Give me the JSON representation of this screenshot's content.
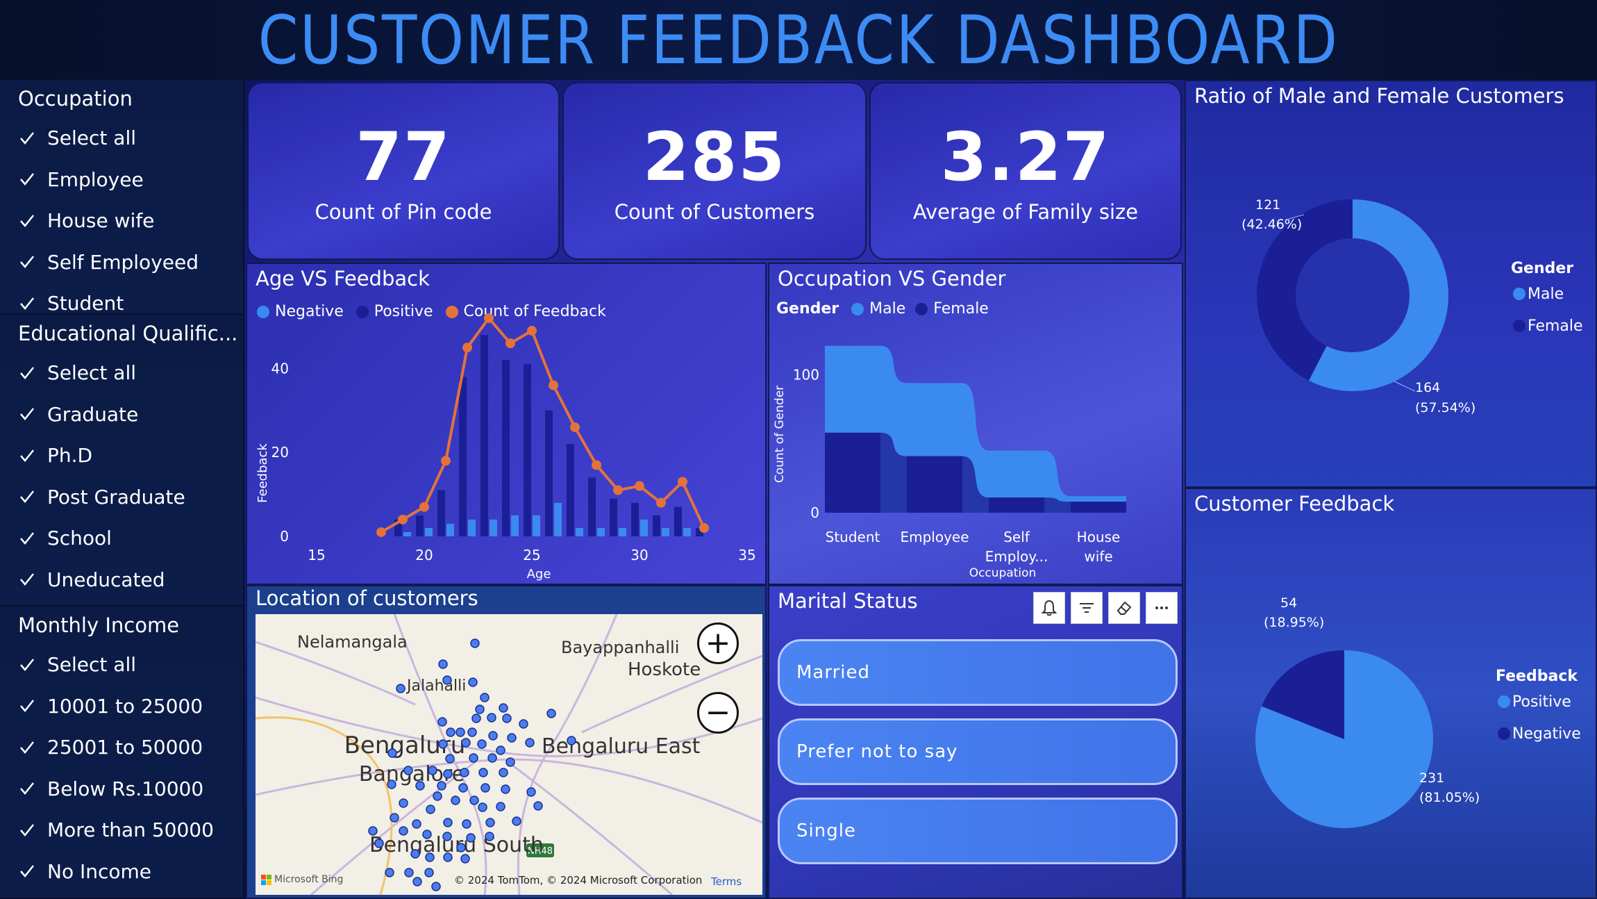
{
  "header": {
    "title": "CUSTOMER FEEDBACK DASHBOARD"
  },
  "slicers": {
    "occupation": {
      "title": "Occupation",
      "items": [
        "Select all",
        "Employee",
        "House wife",
        "Self Employeed",
        "Student"
      ]
    },
    "education": {
      "title": "Educational Qualific...",
      "items": [
        "Select all",
        "Graduate",
        "Ph.D",
        "Post Graduate",
        "School",
        "Uneducated"
      ]
    },
    "income": {
      "title": "Monthly Income",
      "items": [
        "Select all",
        "10001 to 25000",
        "25001 to 50000",
        "Below Rs.10000",
        "More than 50000",
        "No Income"
      ]
    }
  },
  "kpis": [
    {
      "value": "77",
      "label": "Count of Pin code"
    },
    {
      "value": "285",
      "label": "Count of Customers"
    },
    {
      "value": "3.27",
      "label": "Average of Family size"
    }
  ],
  "colors": {
    "light_blue": "#3b8af0",
    "dark_blue": "#1a1f96",
    "orange": "#e3733a",
    "title_blue": "#3d8cf5"
  },
  "age_chart": {
    "title": "Age VS Feedback",
    "legend": [
      "Negative",
      "Positive",
      "Count of Feedback"
    ]
  },
  "occupation_chart": {
    "title": "Occupation VS Gender",
    "legend_title": "Gender",
    "legend": [
      "Male",
      "Female"
    ],
    "ylabel": "Count of Gender",
    "xlabel": "Occupation",
    "categories": [
      "Student",
      "Employee",
      "Self Employ...",
      "House wife"
    ],
    "yticks": [
      "100",
      "0"
    ]
  },
  "gender_chart": {
    "title": "Ratio of Male and Female Customers",
    "legend_title": "Gender",
    "legend": [
      "Male",
      "Female"
    ],
    "male_label": "164",
    "male_pct": "(57.54%)",
    "female_label": "121",
    "female_pct": "(42.46%)"
  },
  "feedback_chart": {
    "title": "Customer Feedback",
    "legend_title": "Feedback",
    "legend": [
      "Positive",
      "Negative"
    ],
    "positive_label": "231",
    "positive_pct": "(81.05%)",
    "negative_label": "54",
    "negative_pct": "(18.95%)"
  },
  "map": {
    "title": "Location of customers",
    "places": [
      "Nelamangala",
      "Bayappanhalli",
      "Hoskote",
      "Jalahalli",
      "Bengaluru",
      "Bengaluru East",
      "Bangalore",
      "Bengaluru South"
    ],
    "road_label": "NH48",
    "provider": "Microsoft Bing",
    "copyright": "© 2024 TomTom, © 2024 Microsoft Corporation",
    "terms": "Terms",
    "zoom_in": "+",
    "zoom_out": "−"
  },
  "marital": {
    "title": "Marital Status",
    "items": [
      "Married",
      "Prefer not to say",
      "Single"
    ]
  },
  "chart_data": [
    {
      "type": "bar",
      "title": "Age VS Feedback",
      "xlabel": "Age",
      "ylabel": "Feedback",
      "xlim": [
        15,
        35
      ],
      "ylim": [
        0,
        50
      ],
      "xticks": [
        15,
        20,
        25,
        30,
        35
      ],
      "yticks": [
        0,
        20,
        40
      ],
      "x": [
        18,
        19,
        20,
        21,
        22,
        23,
        24,
        25,
        26,
        27,
        28,
        29,
        30,
        31,
        32,
        33
      ],
      "series": [
        {
          "name": "Negative",
          "values": [
            0,
            1,
            2,
            3,
            4,
            4,
            5,
            5,
            8,
            2,
            2,
            2,
            4,
            2,
            2,
            0
          ]
        },
        {
          "name": "Positive",
          "values": [
            0,
            4,
            5,
            11,
            38,
            48,
            42,
            41,
            30,
            22,
            14,
            9,
            8,
            5,
            7,
            2
          ]
        },
        {
          "name": "Count of Feedback",
          "values": [
            1,
            4,
            7,
            18,
            45,
            52,
            46,
            49,
            36,
            26,
            17,
            11,
            12,
            8,
            13,
            2
          ]
        }
      ]
    },
    {
      "type": "area",
      "title": "Occupation VS Gender",
      "categories": [
        "Student",
        "Employee",
        "Self Employ...",
        "House wife"
      ],
      "series": [
        {
          "name": "Male",
          "values": [
            63,
            53,
            34,
            4
          ]
        },
        {
          "name": "Female",
          "values": [
            58,
            41,
            11,
            8
          ]
        }
      ]
    },
    {
      "type": "pie",
      "title": "Ratio of Male and Female Customers",
      "categories": [
        "Male",
        "Female"
      ],
      "values": [
        164,
        121
      ]
    },
    {
      "type": "pie",
      "title": "Customer Feedback",
      "categories": [
        "Positive",
        "Negative"
      ],
      "values": [
        231,
        54
      ]
    }
  ]
}
